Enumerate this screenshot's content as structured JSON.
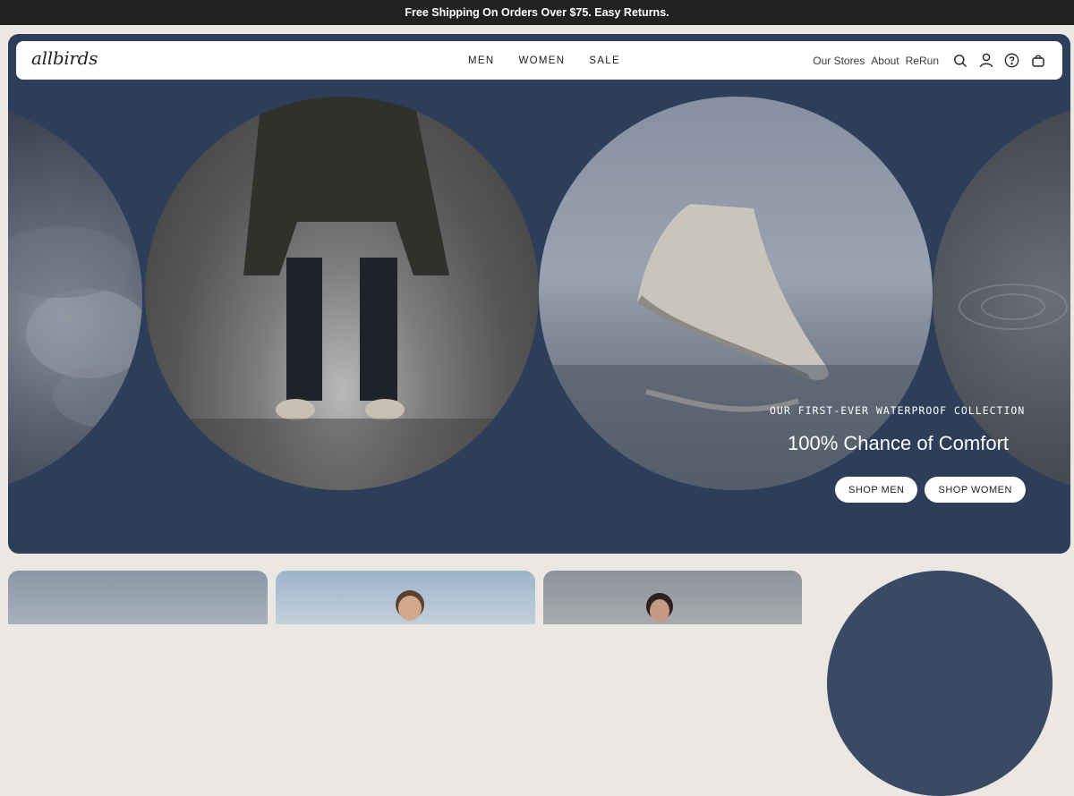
{
  "announcement": {
    "text": "Free Shipping On Orders Over $75. Easy Returns."
  },
  "header": {
    "logo": "allbirds",
    "main_nav": [
      {
        "label": "MEN"
      },
      {
        "label": "WOMEN"
      },
      {
        "label": "SALE"
      }
    ],
    "secondary_nav": [
      {
        "label": "Our Stores"
      },
      {
        "label": "About"
      },
      {
        "label": "ReRun"
      }
    ],
    "icons": [
      "search-icon",
      "account-icon",
      "help-icon",
      "cart-icon"
    ]
  },
  "hero": {
    "eyebrow": "OUR FIRST-EVER WATERPROOF COLLECTION",
    "title": "100% Chance of Comfort",
    "buttons": [
      {
        "label": "SHOP MEN"
      },
      {
        "label": "SHOP WOMEN"
      }
    ]
  },
  "colors": {
    "hero_bg": "#2c3e5a",
    "page_bg": "#ebe8e3",
    "announcement_bg": "#212121"
  }
}
